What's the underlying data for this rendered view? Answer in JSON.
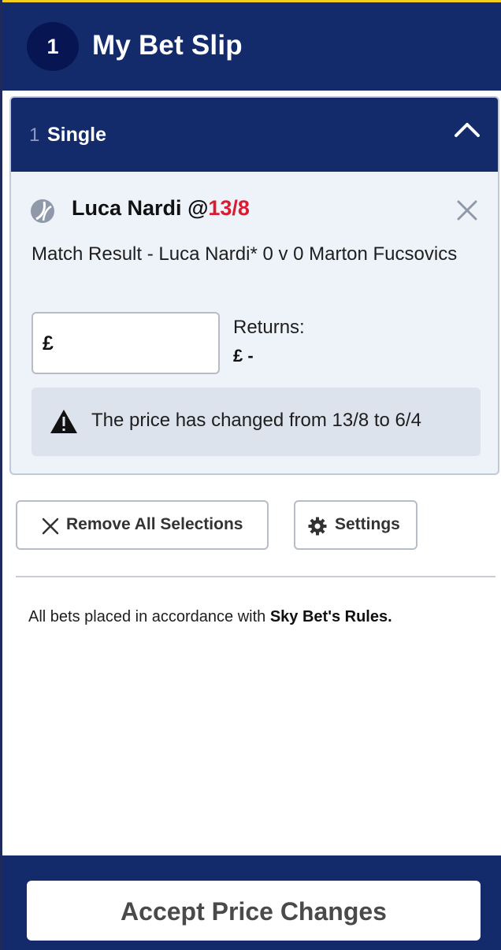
{
  "header": {
    "selection_count": "1",
    "title": "My Bet Slip"
  },
  "bet_group": {
    "count": "1",
    "label": "Single",
    "toggle_icon": "chevron-up-icon"
  },
  "selection": {
    "sport_icon": "tennis-ball-icon",
    "name": "Luca Nardi",
    "at": "@",
    "odds": "13/8",
    "odds_color": "#d71d31",
    "market": "Match Result - Luca Nardi* 0 v 0 Marton Fucsovics",
    "stake_currency": "£",
    "stake_value": "",
    "returns_label": "Returns:",
    "returns_value": "£ -",
    "price_change_message": "The price has changed from 13/8 to 6/4"
  },
  "actions": {
    "remove_all_label": "Remove All Selections",
    "settings_label": "Settings"
  },
  "rules": {
    "prefix": "All bets placed in accordance with",
    "link": "Sky Bet's Rules."
  },
  "footer": {
    "accept_label": "Accept Price Changes"
  },
  "colors": {
    "brand_navy": "#132b6b",
    "accent_yellow": "#f2cf1d",
    "card_background": "#eef2f9",
    "alert_background": "#dde3ec"
  }
}
